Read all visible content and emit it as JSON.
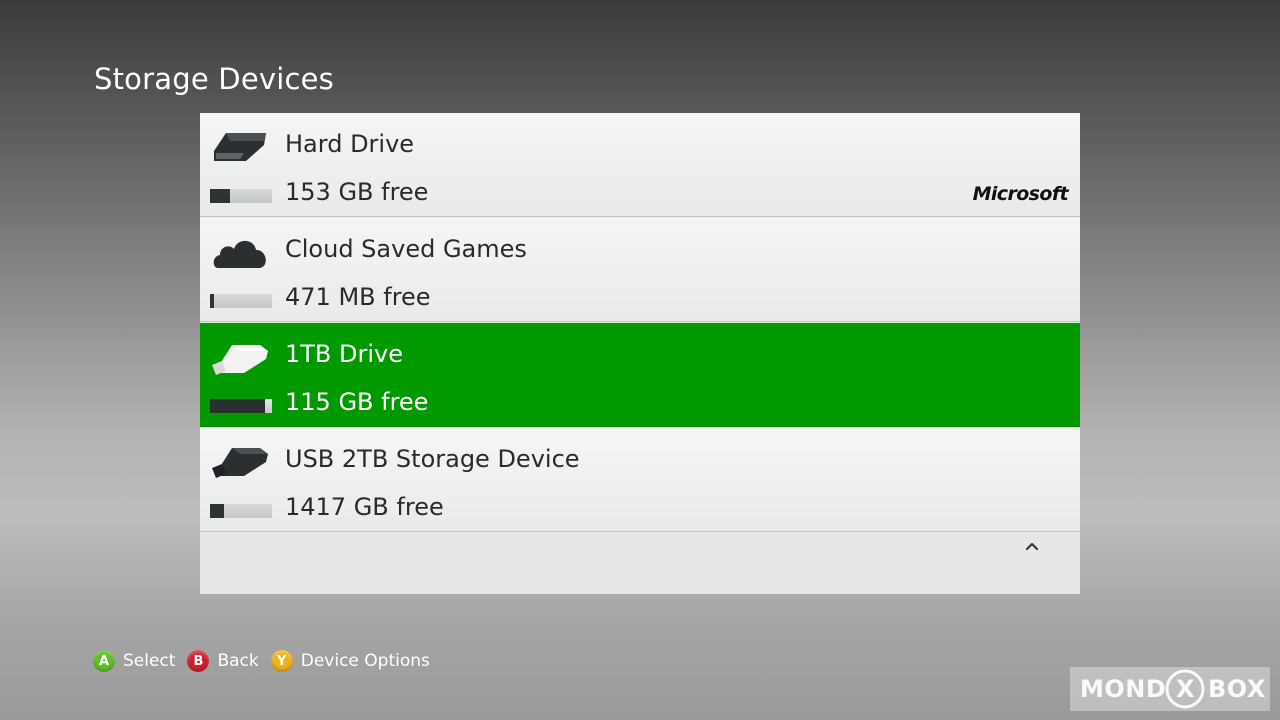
{
  "screen": {
    "title": "Storage Devices"
  },
  "devices": [
    {
      "name": "Hard Drive",
      "free": "153 GB free",
      "icon": "hard-drive-icon",
      "used_fraction": 0.32,
      "selected": false,
      "brand_logo": "Microsoft"
    },
    {
      "name": "Cloud Saved Games",
      "free": "471 MB free",
      "icon": "cloud-icon",
      "used_fraction": 0.06,
      "selected": false
    },
    {
      "name": "1TB Drive",
      "free": "115 GB free",
      "icon": "usb-drive-icon",
      "used_fraction": 0.88,
      "selected": true
    },
    {
      "name": "USB 2TB Storage Device",
      "free": "1417 GB free",
      "icon": "usb-drive-icon",
      "used_fraction": 0.22,
      "selected": false
    }
  ],
  "scroll": {
    "icon": "chevron-up-icon"
  },
  "footer": {
    "hints": [
      {
        "button": "A",
        "label": "Select",
        "color": "#5fbf2a"
      },
      {
        "button": "B",
        "label": "Back",
        "color": "#d0202c"
      },
      {
        "button": "Y",
        "label": "Device Options",
        "color": "#f0b21e"
      }
    ]
  },
  "watermark": {
    "left": "MOND",
    "center": "X",
    "right": "BOX"
  },
  "colors": {
    "selected_row": "#009a00",
    "row_background": "#eceeec",
    "meter_fill": "#2e3436"
  }
}
